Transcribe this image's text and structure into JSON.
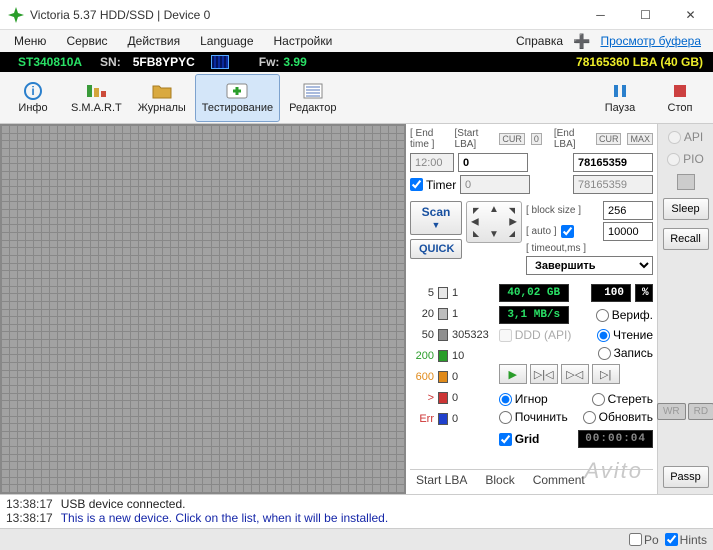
{
  "window": {
    "title": "Victoria 5.37 HDD/SSD | Device 0"
  },
  "menu": {
    "items": [
      "Меню",
      "Сервис",
      "Действия",
      "Language",
      "Настройки"
    ],
    "help": "Справка",
    "buffer": "Просмотр буфера"
  },
  "status": {
    "model": "ST340810A",
    "sn_label": "SN:",
    "sn": "5FB8YPYC",
    "fw_label": "Fw:",
    "fw": "3.99",
    "lba": "78165360 LBA (40 GB)"
  },
  "toolbar": {
    "info": "Инфо",
    "smart": "S.M.A.R.T",
    "logs": "Журналы",
    "test": "Тестирование",
    "editor": "Редактор",
    "pause": "Пауза",
    "stop": "Стоп"
  },
  "scan": {
    "endtime_label": "[ End time ]",
    "endtime": "12:00",
    "startlba_label": "[Start LBA]",
    "startlba": "0",
    "startlba2": "0",
    "endlba_label": "[End LBA]",
    "endlba": "78165359",
    "endlba2": "78165359",
    "cur_tag": "CUR",
    "max_tag": "MAX",
    "zero_tag": "0",
    "timer_label": "Timer",
    "scan_btn": "Scan",
    "quick_btn": "QUICK",
    "blocksize_label": "[ block size ]",
    "blocksize": "256",
    "auto_label": "[ auto ]",
    "timeout_label": "[ timeout,ms ]",
    "timeout": "10000",
    "finish_label": "Завершить"
  },
  "legend": {
    "r1": {
      "v": "5",
      "c": "1"
    },
    "r2": {
      "v": "20",
      "c": "1"
    },
    "r3": {
      "v": "50",
      "c": "305323"
    },
    "r4": {
      "v": "200",
      "c": "10"
    },
    "r5": {
      "v": "600",
      "c": "0"
    },
    "r6": {
      "v": ">",
      "c": "0"
    },
    "r7": {
      "v": "Err",
      "c": "0"
    }
  },
  "display": {
    "size": "40,02 GB",
    "speed": "3,1 MB/s",
    "pct": "100",
    "pct_unit": "%",
    "timer": "00:00:04"
  },
  "opts": {
    "verif": "Вериф.",
    "ddd": "DDD (API)",
    "read": "Чтение",
    "write": "Запись",
    "ignore": "Игнор",
    "erase": "Стереть",
    "fix": "Починить",
    "refresh": "Обновить",
    "grid": "Grid"
  },
  "errtab": {
    "start": "Start LBA",
    "block": "Block",
    "comment": "Comment"
  },
  "side": {
    "api": "API",
    "pio": "PIO",
    "sleep": "Sleep",
    "recall": "Recall",
    "wr": "WR",
    "rd": "RD",
    "passp": "Passp"
  },
  "log": {
    "l1": {
      "t": "13:38:17",
      "m": "USB device connected."
    },
    "l2": {
      "t": "13:38:17",
      "m": "This is a new device. Click on the list, when it will be installed."
    }
  },
  "footer": {
    "po": "Po",
    "hints": "Hints"
  },
  "watermark": "Avito"
}
